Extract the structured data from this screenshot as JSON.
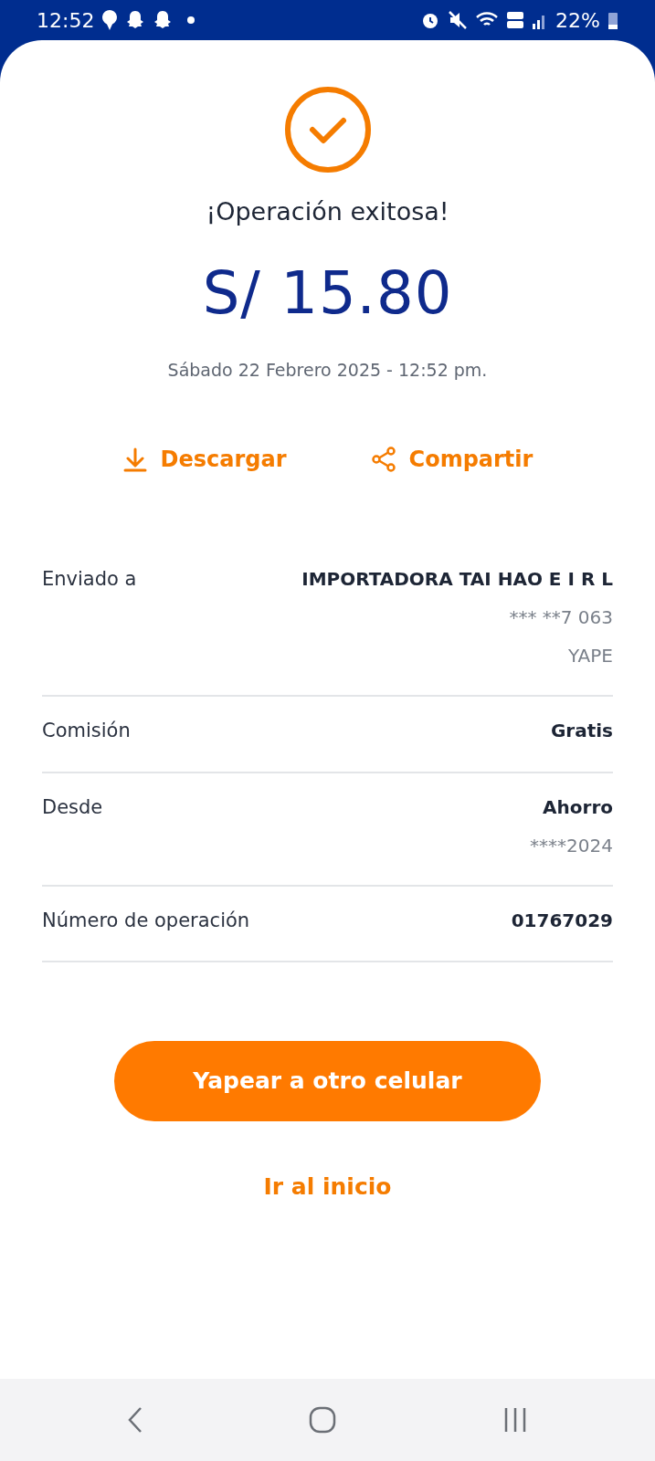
{
  "status_bar": {
    "time": "12:52",
    "battery": "22%"
  },
  "result": {
    "title": "¡Operación exitosa!",
    "amount": "S/ 15.80",
    "datetime": "Sábado 22 Febrero 2025 - 12:52 pm."
  },
  "actions": [
    {
      "kind": "download",
      "label": "Descargar"
    },
    {
      "kind": "share",
      "label": "Compartir"
    }
  ],
  "details": [
    {
      "label": "Enviado a",
      "values": [
        {
          "kind": "primary",
          "text": "IMPORTADORA TAI HAO E I R L"
        },
        {
          "kind": "secondary",
          "text": "*** **7 063"
        },
        {
          "kind": "secondary",
          "text": "YAPE"
        }
      ]
    },
    {
      "label": "Comisión",
      "values": [
        {
          "kind": "primary",
          "text": "Gratis"
        }
      ]
    },
    {
      "label": "Desde",
      "values": [
        {
          "kind": "primary",
          "text": "Ahorro"
        },
        {
          "kind": "secondary",
          "text": "****2024"
        }
      ]
    },
    {
      "label": "Número de operación",
      "values": [
        {
          "kind": "primary",
          "text": "01767029"
        }
      ]
    }
  ],
  "primary_button": "Yapear a otro celular",
  "link": "Ir al inicio"
}
